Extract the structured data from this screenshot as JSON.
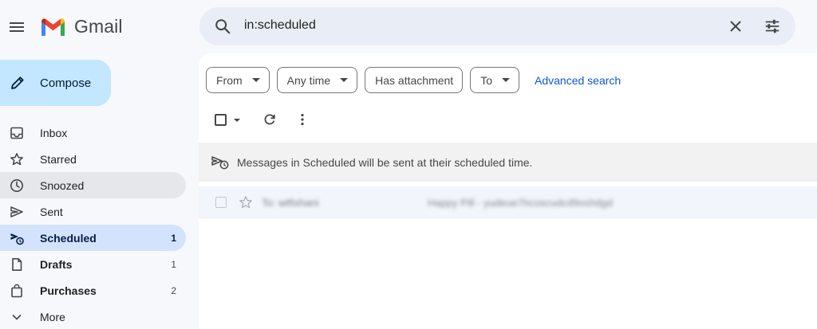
{
  "app": {
    "name": "Gmail",
    "brand_colors": {
      "red": "#ea4335",
      "blue": "#4285f4",
      "green": "#34a853",
      "yellow": "#fbbc04"
    }
  },
  "header": {
    "menu_icon": "hamburger-menu-icon",
    "search": {
      "value": "in:scheduled",
      "icons": [
        "search-icon",
        "close-icon",
        "tune-icon"
      ]
    }
  },
  "sidebar": {
    "compose_label": "Compose",
    "items": [
      {
        "label": "Inbox",
        "icon": "inbox-icon",
        "count": ""
      },
      {
        "label": "Starred",
        "icon": "star-icon",
        "count": ""
      },
      {
        "label": "Snoozed",
        "icon": "clock-icon",
        "count": ""
      },
      {
        "label": "Sent",
        "icon": "send-icon",
        "count": ""
      },
      {
        "label": "Scheduled",
        "icon": "scheduled-send-icon",
        "count": "1",
        "active": true
      },
      {
        "label": "Drafts",
        "icon": "draft-icon",
        "count": "1"
      },
      {
        "label": "Purchases",
        "icon": "shopping-bag-icon",
        "count": "2"
      },
      {
        "label": "More",
        "icon": "chevron-down-icon",
        "count": ""
      }
    ]
  },
  "filters": {
    "chips": [
      "From",
      "Any time",
      "Has attachment",
      "To"
    ],
    "advanced_search": "Advanced search"
  },
  "toolbar": {
    "icons": [
      "select-checkbox",
      "refresh-icon",
      "more-vert-icon"
    ]
  },
  "banner": {
    "text": "Messages in Scheduled will be sent at their scheduled time."
  },
  "messages": [
    {
      "to": "To: wtfishani",
      "subject": "Happy Pill - yudeue7hcoscudcd9oshdgd"
    }
  ],
  "colors": {
    "accent": "#0b57d0",
    "compose_bg": "#c2e7ff",
    "active_nav_bg": "#d3e3fd",
    "search_bg": "#e9eef6"
  }
}
